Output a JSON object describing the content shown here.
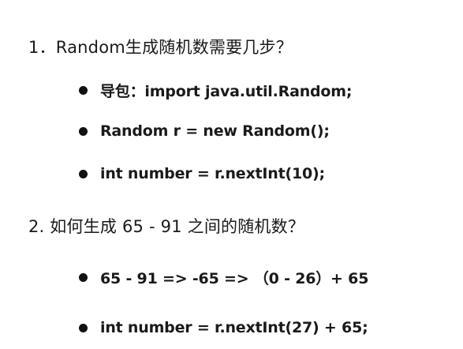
{
  "questions": [
    {
      "text": "1．Random生成随机数需要几步？"
    },
    {
      "text": "2. 如何生成 65 - 91 之间的随机数？"
    }
  ],
  "section1_bullets": [
    {
      "text": "导包：import java.util.Random;"
    },
    {
      "text": "Random r = new Random();"
    },
    {
      "text": "int number = r.nextInt(10);"
    }
  ],
  "section2_bullets": [
    {
      "text": "65 - 91  =>  -65 =>  （0 - 26）+ 65"
    },
    {
      "text": "int number = r.nextInt(27) + 65;"
    }
  ]
}
